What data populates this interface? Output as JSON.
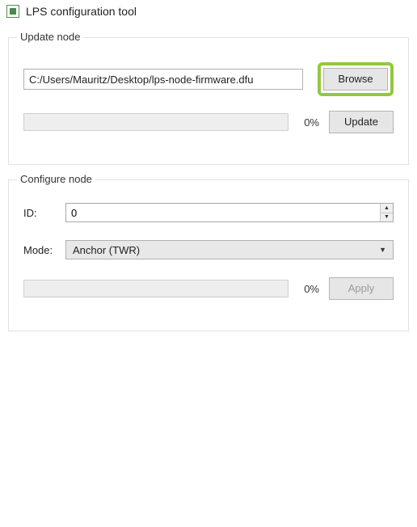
{
  "window": {
    "title": "LPS configuration tool"
  },
  "update_node": {
    "group_title": "Update node",
    "firmware_path": "C:/Users/Mauritz/Desktop/lps-node-firmware.dfu",
    "browse_label": "Browse",
    "progress_pct": "0%",
    "update_label": "Update"
  },
  "configure_node": {
    "group_title": "Configure node",
    "id_label": "ID:",
    "id_value": "0",
    "mode_label": "Mode:",
    "mode_value": "Anchor (TWR)",
    "progress_pct": "0%",
    "apply_label": "Apply"
  }
}
